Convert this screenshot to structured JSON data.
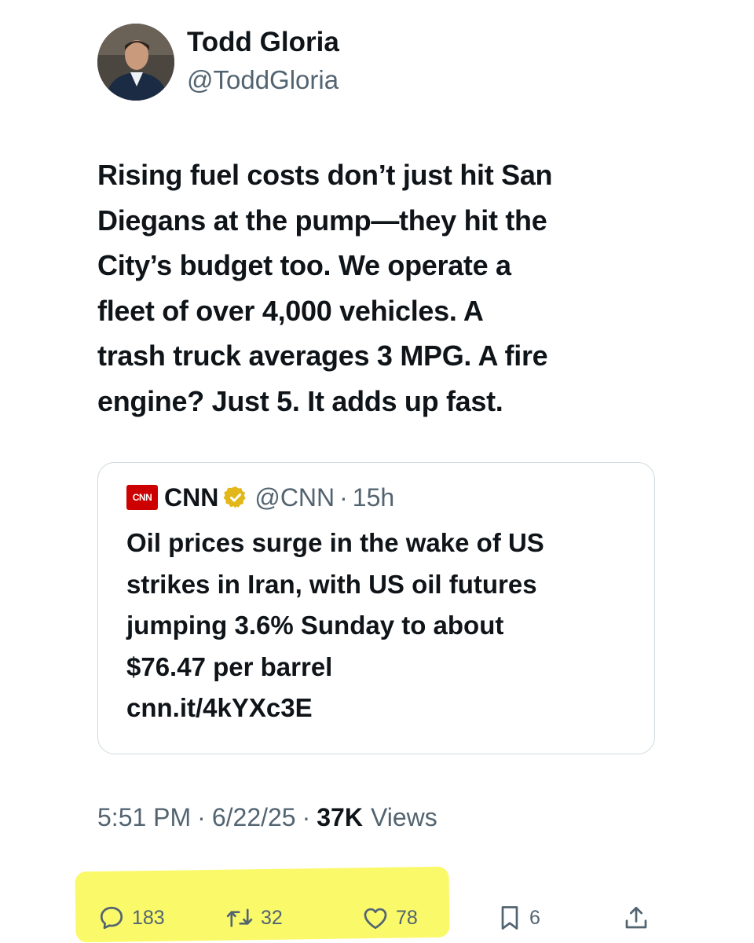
{
  "author": {
    "name": "Todd Gloria",
    "handle": "@ToddGloria",
    "avatar_icon": "avatar-photo"
  },
  "tweet": {
    "lines": [
      "Rising fuel costs don’t just hit San",
      "Diegans at the pump—they hit the",
      "City’s budget too. We operate a",
      "fleet of over 4,000 vehicles. A",
      "trash truck averages 3 MPG. A fire",
      "engine? Just 5. It adds up fast."
    ]
  },
  "quote": {
    "logo_text": "CNN",
    "name": "CNN",
    "verified": true,
    "verified_color": "#e2b719",
    "handle": "@CNN",
    "separator": "·",
    "time": "15h",
    "lines": [
      "Oil prices surge in the wake of US",
      "strikes in Iran, with US oil futures",
      "jumping 3.6% Sunday to about",
      "$76.47 per barrel",
      "cnn.it/4kYXc3E"
    ]
  },
  "meta": {
    "time": "5:51 PM",
    "separator": "·",
    "date": "6/22/25",
    "views_count": "37K",
    "views_label": "Views"
  },
  "actions": {
    "replies": "183",
    "retweets": "32",
    "likes": "78",
    "bookmarks": "6"
  },
  "colors": {
    "text_primary": "#0f1419",
    "text_secondary": "#536471",
    "border": "#cfd9de",
    "highlight": "#faf96a",
    "cnn_red": "#cc0000"
  }
}
